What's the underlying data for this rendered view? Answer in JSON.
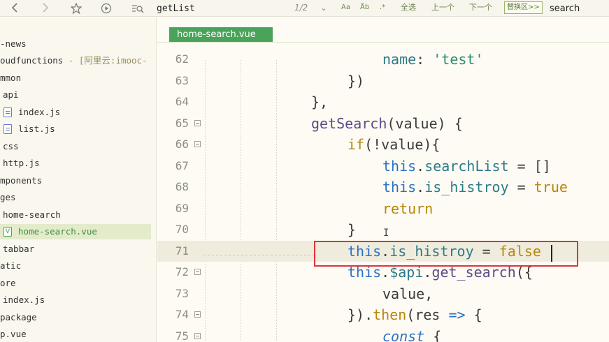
{
  "toolbar": {
    "search_value": "getList",
    "find_count": "1/2",
    "match_case_label": "Aa",
    "regex_label": "Åb",
    "whole_word_label": ".*",
    "select_all_label": "全选",
    "prev_label": "上一个",
    "next_label": "下一个",
    "replace_label": "替换区>>",
    "replace_value": "search"
  },
  "tree": {
    "items": [
      {
        "label": "-news"
      },
      {
        "label": "oudfunctions",
        "suffix": " - [阿里云:imooc-"
      },
      {
        "label": "mmon"
      },
      {
        "label": "api"
      },
      {
        "label": "index.js"
      },
      {
        "label": "list.js"
      },
      {
        "label": "css"
      },
      {
        "label": "http.js"
      },
      {
        "label": "mponents"
      },
      {
        "label": "ges"
      },
      {
        "label": "home-search"
      },
      {
        "label": "home-search.vue"
      },
      {
        "label": "tabbar"
      },
      {
        "label": "atic"
      },
      {
        "label": "ore"
      },
      {
        "label": "index.js"
      },
      {
        "label": "package"
      },
      {
        "label": "p.vue"
      }
    ],
    "vue_icon_glyph": "V"
  },
  "editor": {
    "tab_label": "home-search.vue",
    "ibeam": "I",
    "lines": [
      {
        "n": "62",
        "t": [
          "name",
          ": ",
          "'test'"
        ]
      },
      {
        "n": "63",
        "t": [
          "})"
        ]
      },
      {
        "n": "64",
        "t": [
          "},"
        ]
      },
      {
        "n": "65",
        "t": [
          "getSearch",
          "(value) {"
        ]
      },
      {
        "n": "66",
        "t": [
          "if",
          "(!value){"
        ]
      },
      {
        "n": "67",
        "t": [
          "this",
          ".",
          "searchList",
          " = []"
        ]
      },
      {
        "n": "68",
        "t": [
          "this",
          ".",
          "is_histroy",
          " = ",
          "true"
        ]
      },
      {
        "n": "69",
        "t": [
          "return"
        ]
      },
      {
        "n": "70",
        "t": [
          "}"
        ]
      },
      {
        "n": "71",
        "t": [
          "this",
          ".",
          "is_histroy",
          " = ",
          "false"
        ]
      },
      {
        "n": "72",
        "t": [
          "this",
          ".",
          "$api",
          ".",
          "get_search",
          "({"
        ]
      },
      {
        "n": "73",
        "t": [
          "value,"
        ]
      },
      {
        "n": "74",
        "t": [
          "}).",
          "then",
          "(res ",
          "=>",
          " {"
        ]
      },
      {
        "n": "75",
        "t": [
          "const",
          " {"
        ]
      }
    ]
  }
}
